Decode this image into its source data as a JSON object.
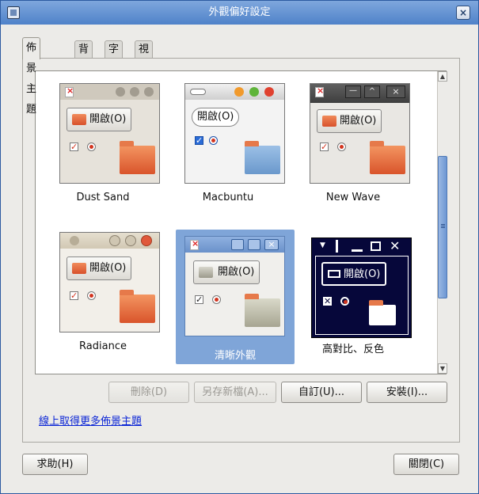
{
  "window": {
    "title": "外觀偏好設定",
    "close_glyph": "×"
  },
  "tabs": [
    {
      "label": "佈景主題",
      "active": true
    },
    {
      "label": "背景",
      "active": false
    },
    {
      "label": "字型",
      "active": false
    },
    {
      "label": "視覺效果",
      "active": false
    }
  ],
  "themes": [
    {
      "name": "Dust Sand",
      "button_label": "開啟(O)",
      "selected": false
    },
    {
      "name": "Macbuntu",
      "button_label": "開啟(O)",
      "selected": false
    },
    {
      "name": "New Wave",
      "button_label": "開啟(O)",
      "selected": false
    },
    {
      "name": "Radiance",
      "button_label": "開啟(O)",
      "selected": false
    },
    {
      "name": "清晰外觀",
      "button_label": "開啟(O)",
      "selected": true
    },
    {
      "name": "高對比、反色",
      "button_label": "開啟(O)",
      "selected": false
    }
  ],
  "actions": {
    "delete": "刪除(D)",
    "save_as": "另存新檔(A)...",
    "customize": "自訂(U)...",
    "install": "安裝(I)..."
  },
  "link": "線上取得更多佈景主題",
  "bottom": {
    "help": "求助(H)",
    "close": "關閉(C)"
  },
  "colors": {
    "selection": "#7fa5d8",
    "link": "#0b25d6",
    "titlebar": "#4f82c9"
  }
}
